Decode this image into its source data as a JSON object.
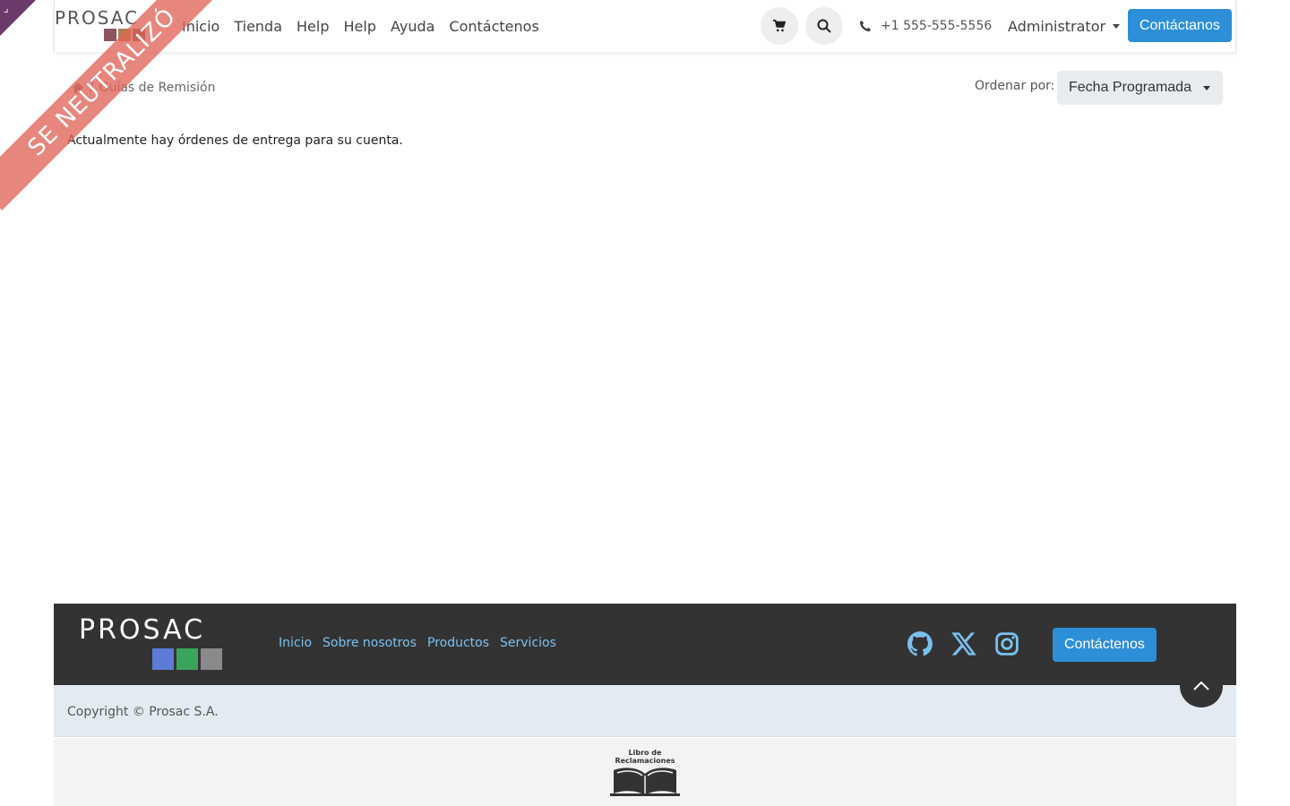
{
  "header": {
    "logo_text": "PROSAC",
    "nav": [
      "Inicio",
      "Tienda",
      "Help",
      "Help",
      "Ayuda",
      "Contáctenos"
    ],
    "phone": "+1 555-555-5556",
    "user": "Administrator",
    "contact_button": "Contáctanos"
  },
  "ribbon": {
    "text": "SE NEUTRALIZÓ"
  },
  "breadcrumb": {
    "current": "Guías de Remisión"
  },
  "sort": {
    "label": "Ordenar por:",
    "value": "Fecha Programada"
  },
  "main": {
    "message": "Actualmente hay órdenes de entrega para su cuenta."
  },
  "footer": {
    "logo_text": "PROSAC",
    "links": [
      "Inicio",
      "Sobre nosotros",
      "Productos",
      "Servicios"
    ],
    "social_icons": [
      "github-icon",
      "x-icon",
      "instagram-icon"
    ],
    "contact_button": "Contáctenos",
    "copyright": "Copyright © Prosac S.A.",
    "libro": [
      "Libro de",
      "Reclamaciones"
    ]
  },
  "colors": {
    "primary": "#2d8fd8",
    "footer_bg": "#333333",
    "footer_link": "#7ac1ef",
    "ribbon": "#e06458",
    "cube_blue": "#5b7bd5",
    "cube_green": "#3aa55a",
    "cube_gray": "#8a8a8a"
  }
}
